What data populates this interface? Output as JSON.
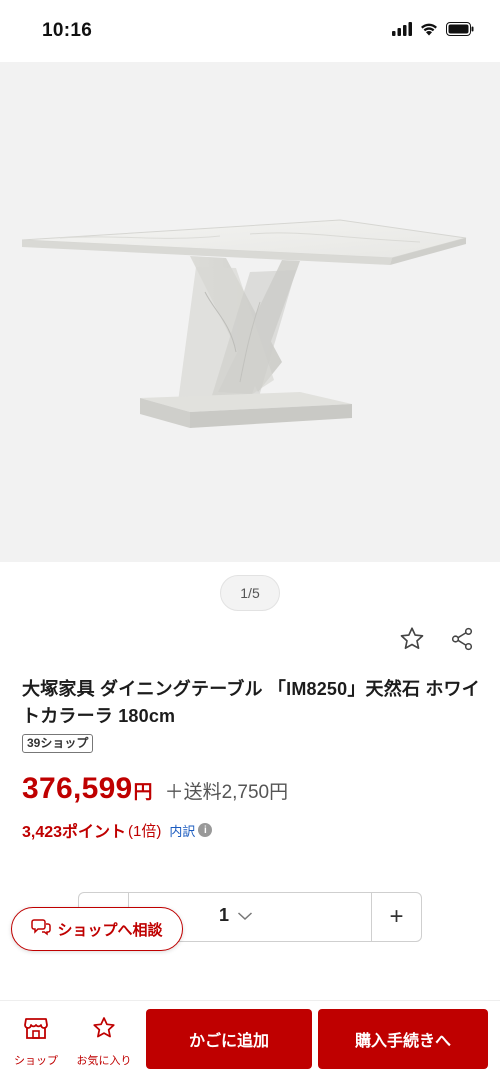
{
  "status_bar": {
    "time": "10:16",
    "icons": [
      "signal-icon",
      "wifi-icon",
      "battery-icon"
    ]
  },
  "gallery": {
    "image_subject": "product-photo",
    "pager": "1/5"
  },
  "product": {
    "title": "大塚家具 ダイニングテーブル 「IM8250」天然石 ホワイトカラーラ 180cm",
    "shop_badge": "39ショップ",
    "price": "376,599",
    "price_unit": "円",
    "shipping": "＋送料2,750円",
    "points": "3,423ポイント",
    "points_rate": "(1倍)",
    "points_breakdown_link": "内訳",
    "quantity": "1"
  },
  "actions": {
    "favorite_icon": "star-icon",
    "share_icon": "share-icon",
    "consult_label": "ショップへ相談",
    "qty_plus": "+"
  },
  "bottom_bar": {
    "shop_label": "ショップ",
    "favorite_label": "お気に入り",
    "add_to_cart": "かごに追加",
    "checkout": "購入手続きへ"
  },
  "colors": {
    "accent": "#bf0000",
    "link": "#1a5bbf"
  }
}
